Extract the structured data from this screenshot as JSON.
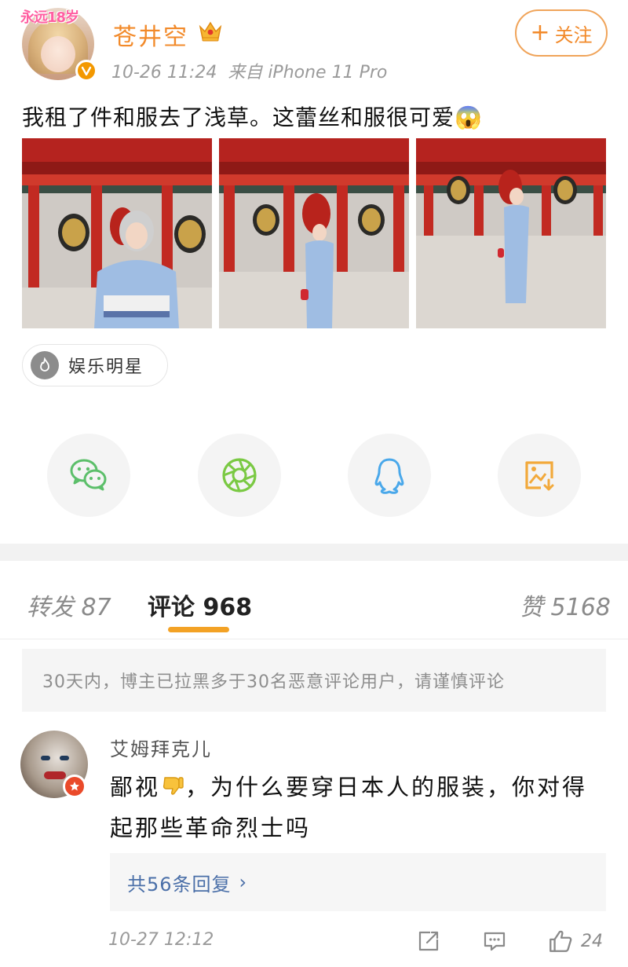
{
  "post": {
    "username": "苍井空",
    "avatar_badge_text": "永远18岁",
    "timestamp": "10-26 11:24",
    "source": "来自 iPhone 11 Pro",
    "follow_label": "关注",
    "text": "我租了件和服去了浅草。这蕾丝和服很可爱😱",
    "photo_count": 3,
    "tag_label": "娱乐明星"
  },
  "share": {
    "icons": [
      "wechat-icon",
      "moments-icon",
      "qq-icon",
      "save-image-icon"
    ]
  },
  "tabs": {
    "reposts_label": "转发 87",
    "comments_label": "评论 968",
    "likes_label": "赞 5168"
  },
  "notice": {
    "text": "30天内，博主已拉黑多于30名恶意评论用户，请谨慎评论"
  },
  "comment": {
    "name": "艾姆拜克儿",
    "text_part1": "鄙视",
    "text_part2": "，为什么要穿日本人的服装，你对得起那些革命烈士吗",
    "replies_label": "共56条回复",
    "time": "10-27 12:12",
    "like_count": "24"
  },
  "colors": {
    "accent": "#f28a2a",
    "tab_underline": "#f3a225",
    "link": "#4a6fa8",
    "wechat": "#5cbf6a",
    "moments": "#7ac943",
    "qq": "#4aa8ea",
    "save": "#f2a93b"
  }
}
